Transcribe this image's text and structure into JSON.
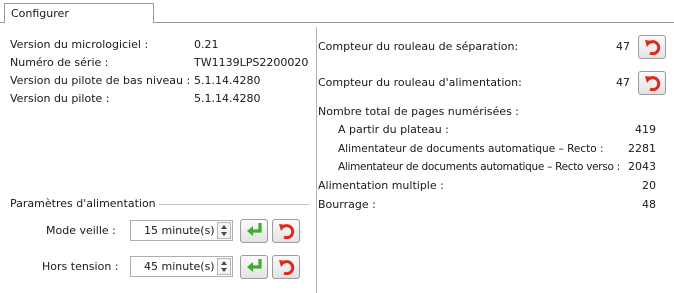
{
  "tab": {
    "label": "Configurer"
  },
  "info": [
    {
      "label": "Version du micrologiciel :",
      "value": "0.21"
    },
    {
      "label": "Numéro de série :",
      "value": "TW1139LPS2200020"
    },
    {
      "label": "Version du pilote de bas niveau :",
      "value": "5.1.14.4280"
    },
    {
      "label": "Version du pilote :",
      "value": "5.1.14.4280"
    }
  ],
  "power": {
    "group_title": "Paramètres d'alimentation",
    "sleep": {
      "label": "Mode veille :",
      "value": "15 minute(s)"
    },
    "off": {
      "label": "Hors tension :",
      "value": "45 minute(s)"
    }
  },
  "counters": {
    "separation_label": "Compteur du rouleau de séparation:",
    "separation_value": "47",
    "feed_label": "Compteur du rouleau d'alimentation:",
    "feed_value": "47",
    "total_label": "Nombre total de pages numérisées :",
    "flatbed_label": "A partir du plateau :",
    "flatbed_value": "419",
    "adf_simplex_label": "Alimentateur de documents automatique – Recto :",
    "adf_simplex_value": "2281",
    "adf_duplex_label": "Alimentateur de documents automatique – Recto verso :",
    "adf_duplex_value": "2043",
    "multifeed_label": "Alimentation multiple :",
    "multifeed_value": "20",
    "jam_label": "Bourrage :",
    "jam_value": "48"
  },
  "colors": {
    "apply_green": "#3cae2c",
    "reset_red": "#e0291c"
  },
  "icons": {
    "apply": "enter-arrow-icon",
    "reset": "undo-arrow-icon"
  }
}
